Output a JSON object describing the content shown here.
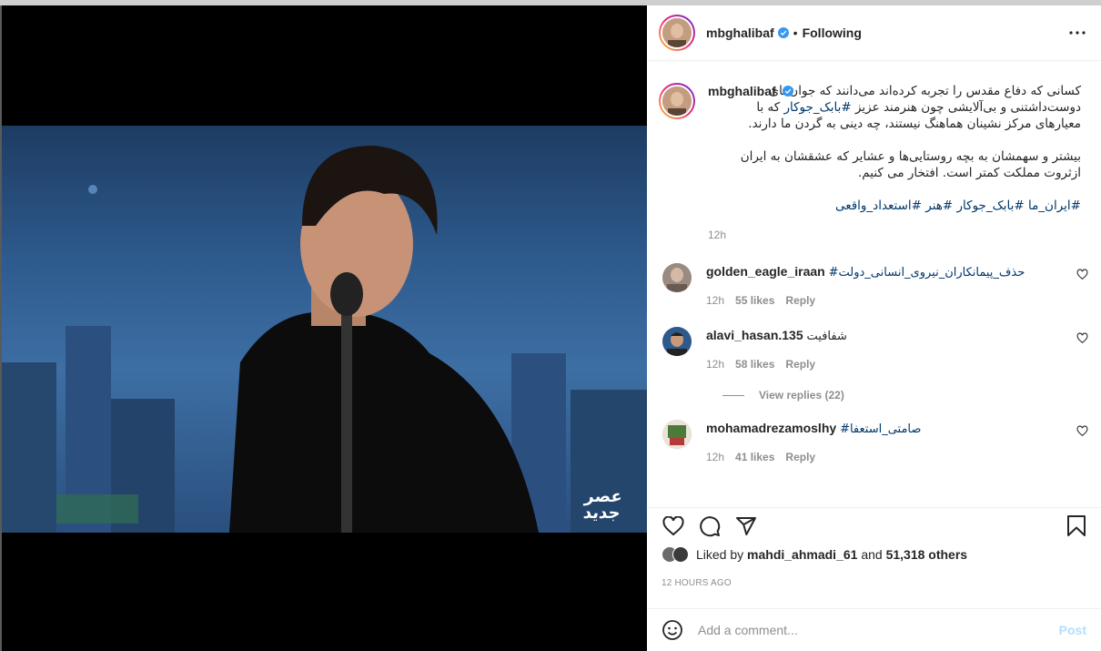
{
  "post": {
    "username": "mbghalibaf",
    "dot": "•",
    "follow_state": "Following"
  },
  "caption": {
    "username": "mbghalibaf",
    "line1": "کسانی که دفاع مقدس را تجربه کرده‌اند می‌دانند که جوان‌های دوست‌داشتنی و بی‌آلایشی چون هنرمند عزیز",
    "hashtag_inline": "#بابک_جوکار",
    "line1b": "که با معیارهای مرکز نشینان هماهنگ نیستند، چه دینی به گردن ما دارند.",
    "line2": "بیشتر و سهمشان به بچه روستایی‌ها و عشایر که عشقشان به ایران ازثروت مملکت کمتر است. افتخار می کنیم.",
    "hashtags": "#ایران_ما #بابک_جوکار #هنر #استعداد_واقعی",
    "time": "12h"
  },
  "comments": [
    {
      "username": "golden_eagle_iraan",
      "text": "#حذف_پیمانکاران_نیروی_انسانی_دولت",
      "time": "12h",
      "likes": "55 likes",
      "reply": "Reply"
    },
    {
      "username": "alavi_hasan.135",
      "text": "شفافیت",
      "time": "12h",
      "likes": "58 likes",
      "reply": "Reply"
    },
    {
      "username": "mohamadrezamoslhy",
      "text": "#صامتی_استعفا",
      "time": "12h",
      "likes": "41 likes",
      "reply": "Reply"
    }
  ],
  "view_replies": "View replies (22)",
  "liked": {
    "prefix": "Liked by",
    "user": "mahdi_ahmadi_61",
    "and": "and",
    "others": "51,318 others"
  },
  "timestamp": "12 HOURS AGO",
  "add_comment": {
    "placeholder": "Add a comment...",
    "post": "Post"
  },
  "media": {
    "logo_text": "عصر جدید"
  },
  "colors": {
    "link": "#00376b",
    "verified": "#3897f0",
    "post_disabled": "#b2dffc",
    "muted": "#8e8e8e"
  }
}
